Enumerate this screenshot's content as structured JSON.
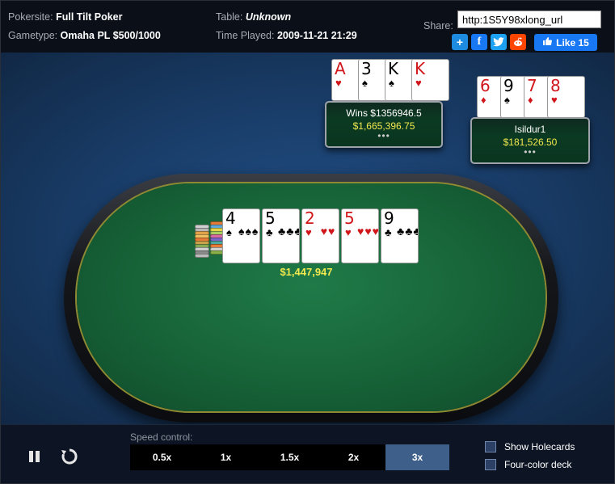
{
  "header": {
    "pokersite_key": "Pokersite:",
    "pokersite_val": "Full Tilt Poker",
    "gametype_key": "Gametype:",
    "gametype_val": "Omaha PL $500/1000",
    "table_key": "Table:",
    "table_val": "Unknown",
    "played_key": "Time Played:",
    "played_val": "2009-11-21 21:29",
    "share_label": "Share:",
    "share_url": "http:1S5Y98xlong_url",
    "share_icons": [
      "plus-icon",
      "facebook-icon",
      "twitter-icon",
      "reddit-icon"
    ],
    "like_label": "Like 15"
  },
  "seats": {
    "top": {
      "name": "Wins $1356946.5",
      "stack": "$1,665,396.75",
      "dots": "•••",
      "cards": [
        {
          "rank": "A",
          "suit": "♥",
          "color": "red"
        },
        {
          "rank": "3",
          "suit": "♠",
          "color": "blk"
        },
        {
          "rank": "K",
          "suit": "♠",
          "color": "blk"
        },
        {
          "rank": "K",
          "suit": "♥",
          "color": "red"
        }
      ]
    },
    "right": {
      "name": "Isildur1",
      "stack": "$181,526.50",
      "dots": "•••",
      "cards": [
        {
          "rank": "6",
          "suit": "♦",
          "color": "red"
        },
        {
          "rank": "9",
          "suit": "♠",
          "color": "blk"
        },
        {
          "rank": "7",
          "suit": "♦",
          "color": "red"
        },
        {
          "rank": "8",
          "suit": "♥",
          "color": "red"
        }
      ]
    }
  },
  "board": [
    {
      "rank": "4",
      "suit": "♠",
      "color": "blk"
    },
    {
      "rank": "5",
      "suit": "♣",
      "color": "blk"
    },
    {
      "rank": "2",
      "suit": "♥",
      "color": "red"
    },
    {
      "rank": "5",
      "suit": "♥",
      "color": "red"
    },
    {
      "rank": "9",
      "suit": "♣",
      "color": "blk"
    }
  ],
  "pot": "$1,447,947",
  "controls": {
    "speed_label": "Speed control:",
    "speeds": [
      "0.5x",
      "1x",
      "1.5x",
      "2x",
      "3x"
    ],
    "active_speed": "3x",
    "show_holecards": "Show Holecards",
    "four_color": "Four-color deck"
  },
  "colors": {
    "felt": "#176338",
    "stack_text": "#f1e94e",
    "active_speed": "#3e5f8a"
  }
}
